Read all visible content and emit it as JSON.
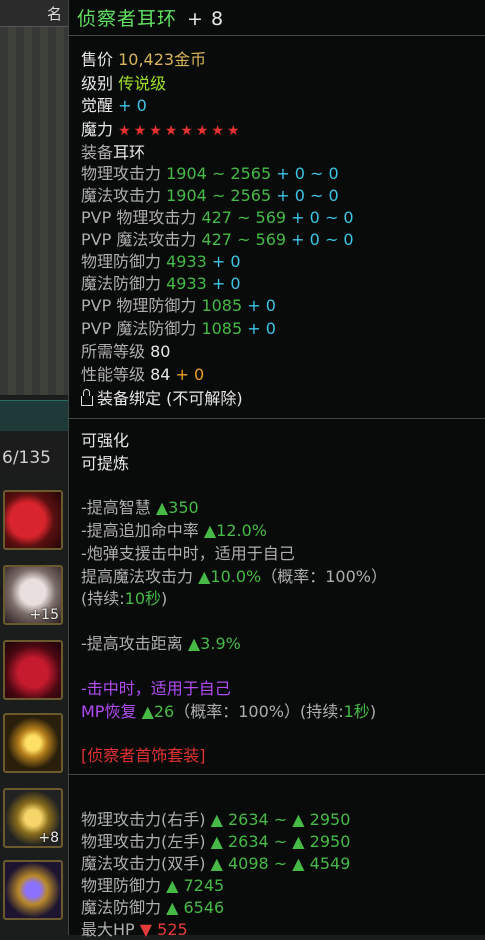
{
  "bg": {
    "top_label": "名",
    "count": "6/135",
    "slots": [
      {
        "icon": "gauntlet-icon",
        "num": ""
      },
      {
        "icon": "pants-icon",
        "num": "+15"
      },
      {
        "icon": "boots-icon",
        "num": ""
      },
      {
        "icon": "necklace-icon",
        "num": ""
      },
      {
        "icon": "ring-icon",
        "num": "+8"
      },
      {
        "icon": "gem-earring-icon",
        "num": ""
      }
    ]
  },
  "item": {
    "name": "侦察者耳环",
    "enhance": "+ 8",
    "price_label": "售价",
    "price_value": "10,423金币",
    "grade_label": "级别",
    "grade_value": "传说级",
    "awaken_label": "觉醒",
    "awaken_value": "+ 0",
    "magic_label": "魔力",
    "magic_stars": "★★★★★★★★",
    "equip_label": "装备",
    "equip_value": "耳环",
    "stats": [
      {
        "label": "物理攻击力",
        "value": "1904 ~ 2565",
        "bonus": " + 0 ~ 0"
      },
      {
        "label": "魔法攻击力",
        "value": "1904 ~ 2565",
        "bonus": " + 0 ~ 0"
      },
      {
        "label": "PVP 物理攻击力",
        "value": "427 ~ 569",
        "bonus": " + 0 ~ 0"
      },
      {
        "label": "PVP 魔法攻击力",
        "value": "427 ~ 569",
        "bonus": " + 0 ~ 0"
      },
      {
        "label": "物理防御力",
        "value": "4933",
        "bonus": " + 0"
      },
      {
        "label": "魔法防御力",
        "value": "4933",
        "bonus": " + 0"
      },
      {
        "label": "PVP 物理防御力",
        "value": "1085",
        "bonus": " + 0"
      },
      {
        "label": "PVP 魔法防御力",
        "value": "1085",
        "bonus": " + 0"
      }
    ],
    "req_level_label": "所需等级",
    "req_level_value": "80",
    "perf_level_label": "性能等级",
    "perf_level_value": "84",
    "perf_level_bonus": " + 0",
    "bind_text": "装备绑定 (不可解除)"
  },
  "options": {
    "enhanceable": "可强化",
    "refinable": "可提炼",
    "lines": [
      {
        "prefix": "-提高智慧 ",
        "value": "▲350"
      },
      {
        "prefix": "-提高追加命中率 ",
        "value": "▲12.0%"
      },
      {
        "prefix": "-炮弹支援击中时，适用于自己",
        "value": ""
      },
      {
        "prefix": " 提高魔法攻击力 ",
        "value": "▲10.0%",
        "suffix": "（概率：100%）"
      },
      {
        "prefix": " (持续:",
        "value": "10秒",
        "suffix": ")"
      }
    ],
    "range_prefix": "-提高攻击距离 ",
    "range_value": "▲3.9%",
    "hit_text": "-击中时，适用于自己",
    "mp_label": " MP恢复",
    "mp_value": "▲26",
    "mp_suffix_a": "（概率：100%）(持续:",
    "mp_duration": "1秒",
    "mp_suffix_b": ")",
    "set_name": "[侦察者首饰套装]"
  },
  "set_bonus": [
    {
      "label": "物理攻击力(右手)",
      "value": "▲ 2634 ~ ▲ 2950"
    },
    {
      "label": "物理攻击力(左手)",
      "value": "▲ 2634 ~ ▲ 2950"
    },
    {
      "label": "魔法攻击力(双手)",
      "value": "▲ 4098 ~ ▲ 4549"
    },
    {
      "label": "物理防御力",
      "value": "▲ 7245"
    },
    {
      "label": "魔法防御力",
      "value": "▲ 6546"
    }
  ],
  "hp_line": {
    "label": "最大HP",
    "value": "▼ 525"
  }
}
